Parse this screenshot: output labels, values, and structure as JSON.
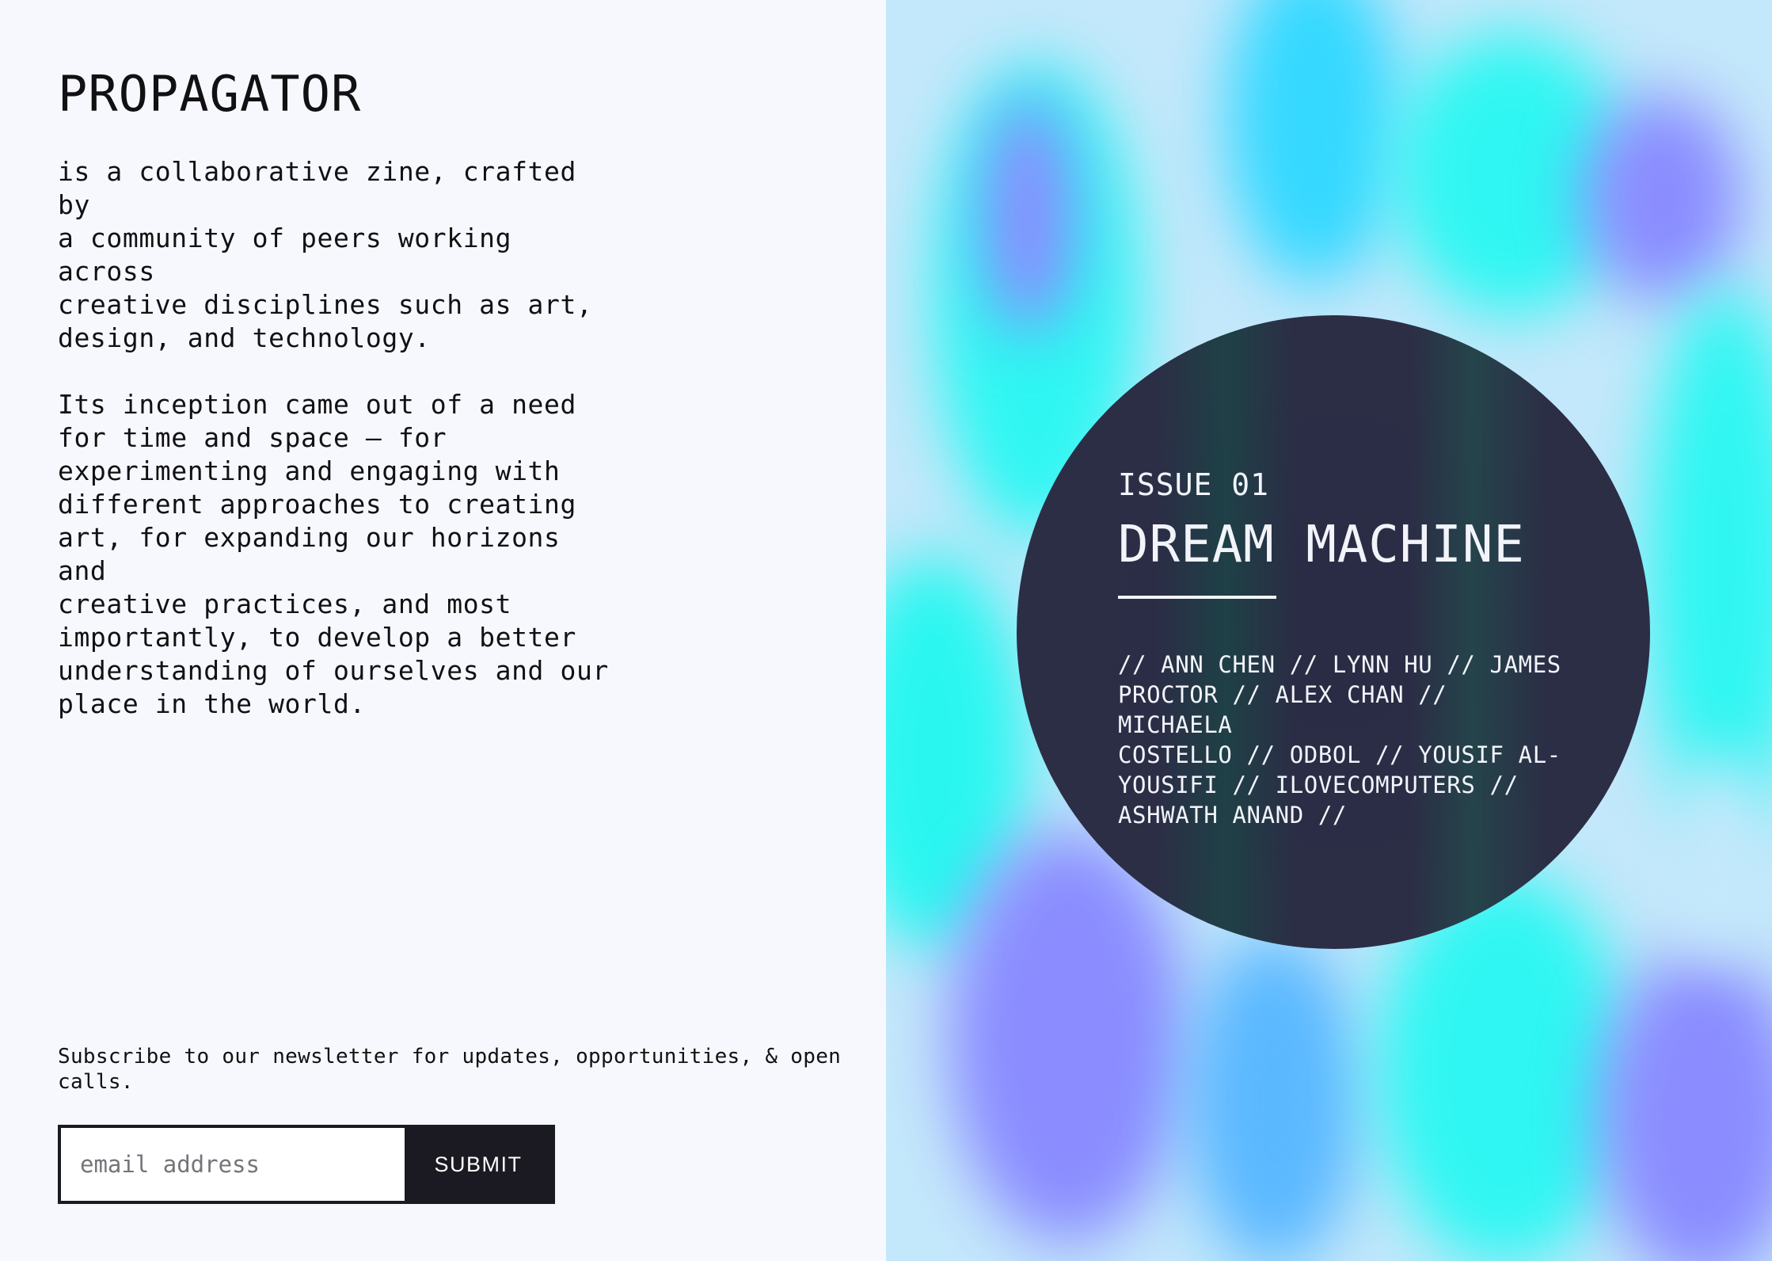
{
  "brand": "PROPAGATOR",
  "intro": {
    "p1": "is a collaborative zine, crafted by\na community of peers working across\ncreative disciplines such as art,\ndesign, and technology.",
    "p2": "Its inception came out of a need\nfor time and space — for\nexperimenting and engaging with\ndifferent approaches to creating\nart, for expanding our horizons and\ncreative practices, and most\nimportantly, to develop a better\nunderstanding of ourselves and our\nplace in the world."
  },
  "newsletter": {
    "text": "Subscribe to our newsletter for updates, opportunities, & open\ncalls.",
    "email_placeholder": "email address",
    "email_value": "",
    "submit_label": "SUBMIT"
  },
  "issue": {
    "number": "ISSUE 01",
    "title": "DREAM MACHINE",
    "credits": "// ANN CHEN // LYNN HU // JAMES\nPROCTOR // ALEX CHAN // MICHAELA\nCOSTELLO // ODBOL // YOUSIF AL-\nYOUSIFI // ILOVECOMPUTERS //\nASHWATH ANAND //"
  },
  "colors": {
    "page_bg": "#f7f8fd",
    "ink": "#111114",
    "button_bg": "#1b1a22",
    "disc_bg": "#2a2c45",
    "cyan": "#2ff6f2",
    "violet": "#8a8cff",
    "sky": "#c4e8fb"
  }
}
